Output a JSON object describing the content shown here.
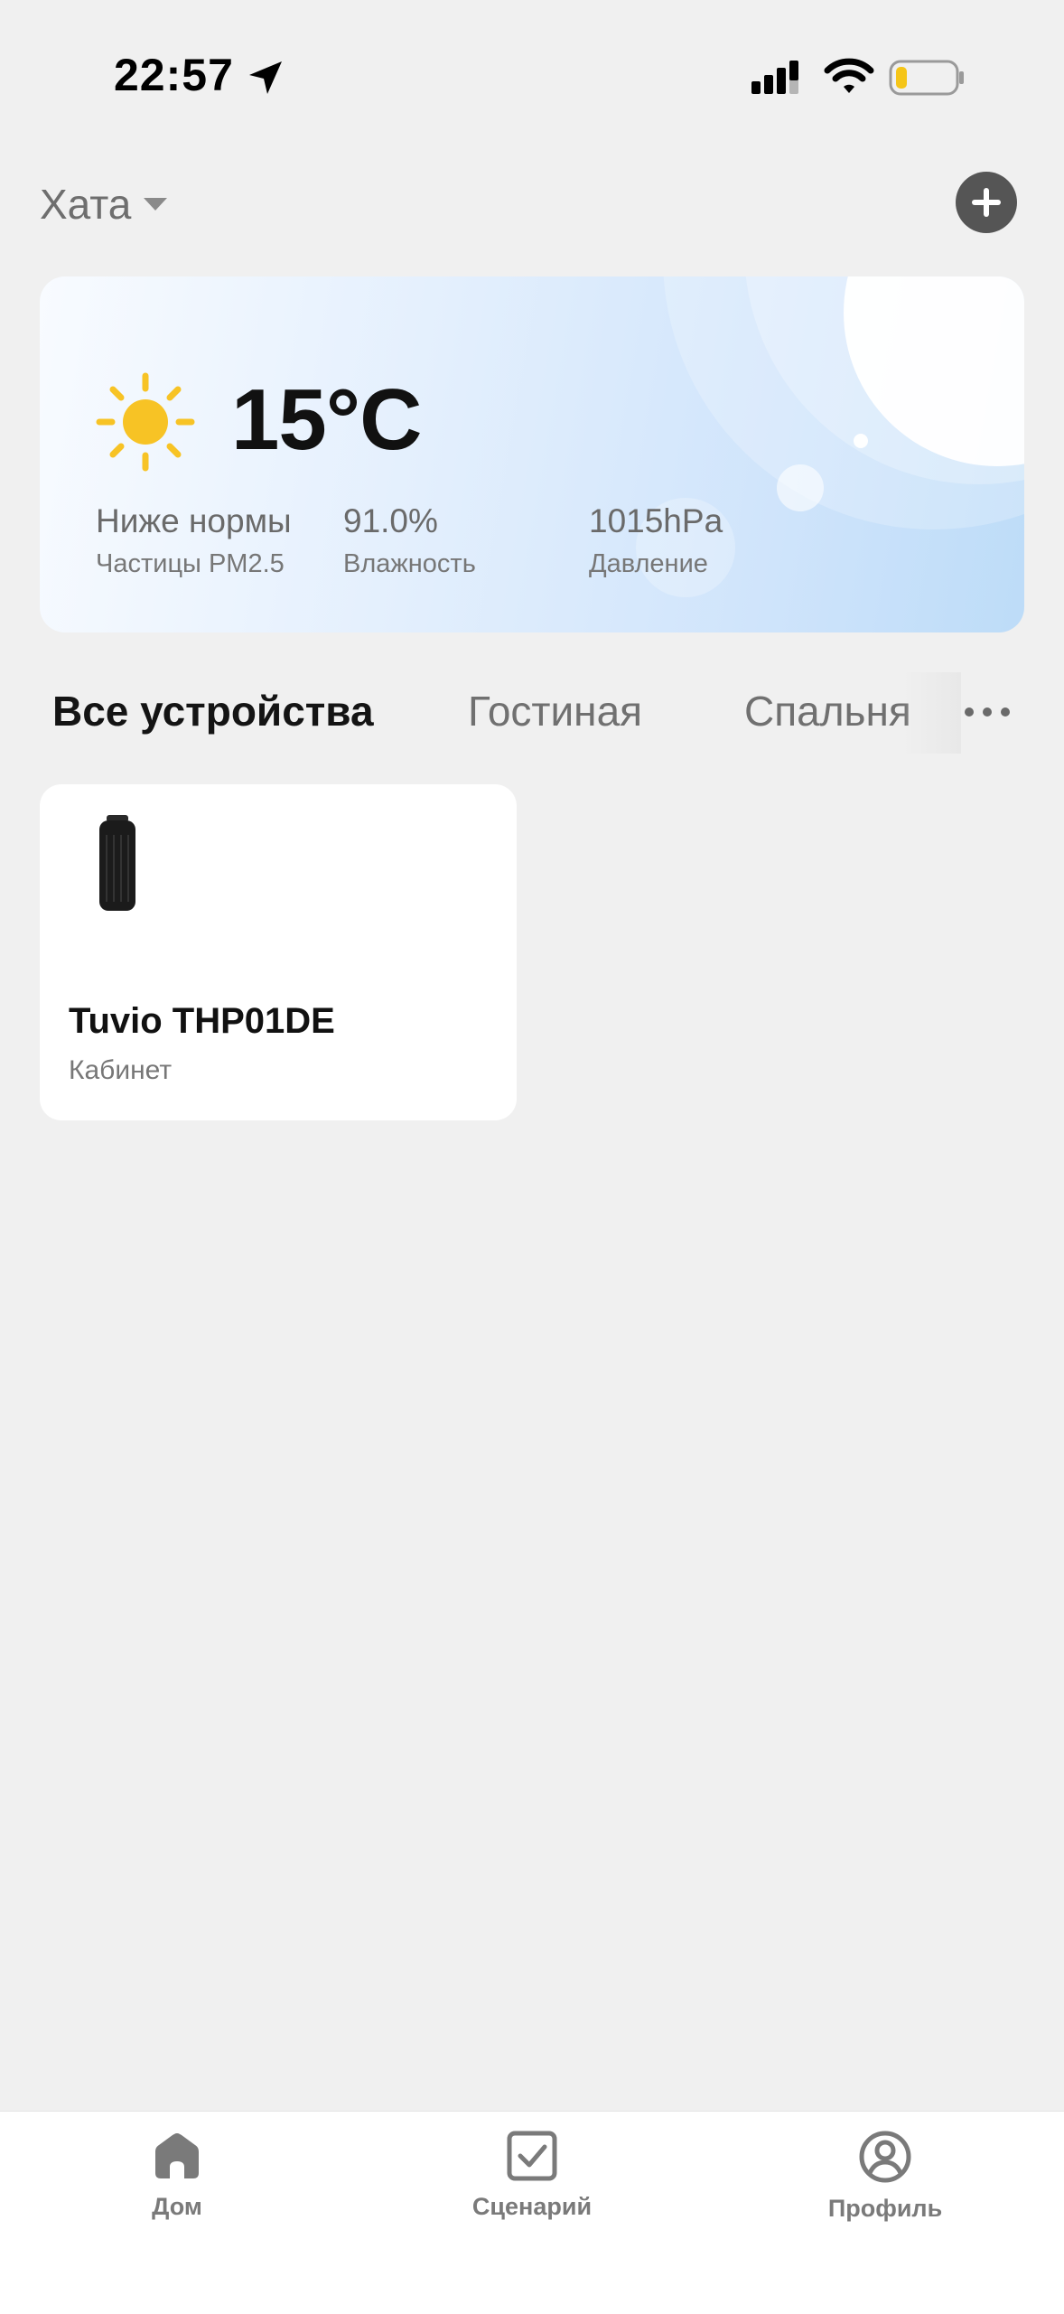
{
  "status_bar": {
    "time": "22:57",
    "icons": [
      "location-arrow-icon",
      "cellular-signal-icon",
      "wifi-icon",
      "battery-low-icon"
    ],
    "battery_color": "#f5c518"
  },
  "header": {
    "home_name": "Хата",
    "add_icon": "plus-icon"
  },
  "weather": {
    "icon": "sun-icon",
    "temperature": "15°C",
    "metrics": [
      {
        "value": "Ниже нормы",
        "label": "Частицы PM2.5"
      },
      {
        "value": "91.0%",
        "label": "Влажность"
      },
      {
        "value": "1015hPa",
        "label": "Давление"
      }
    ]
  },
  "tabs": {
    "items": [
      "Все устройства",
      "Гостиная",
      "Спальня"
    ],
    "active_index": 0,
    "more_icon": "more-dots-icon"
  },
  "devices": [
    {
      "name": "Tuvio THP01DE",
      "room": "Кабинет",
      "image": "air-purifier-image"
    }
  ],
  "bottom_nav": {
    "items": [
      {
        "label": "Дом",
        "icon": "home-icon"
      },
      {
        "label": "Сценарий",
        "icon": "scenario-checkbox-icon"
      },
      {
        "label": "Профиль",
        "icon": "profile-icon"
      }
    ]
  },
  "colors": {
    "background": "#f0f0f0",
    "nav_icon": "#7a7a7a",
    "sun": "#f7c325",
    "add_button": "#555555"
  }
}
